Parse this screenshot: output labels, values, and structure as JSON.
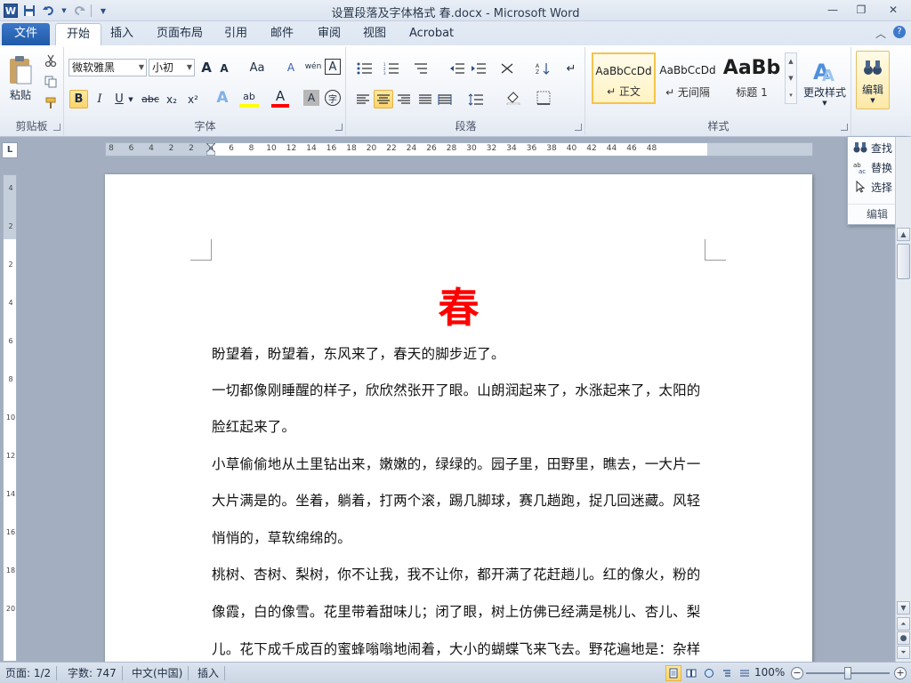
{
  "window": {
    "title": "设置段落及字体格式 春.docx - Microsoft Word",
    "app_icon": "W",
    "minimize": "—",
    "maximize": "❐",
    "close": "✕"
  },
  "tabs": {
    "file": "文件",
    "items": [
      "开始",
      "插入",
      "页面布局",
      "引用",
      "邮件",
      "审阅",
      "视图",
      "Acrobat"
    ],
    "active": "开始"
  },
  "ribbon": {
    "clipboard": {
      "label": "剪贴板",
      "paste": "粘贴"
    },
    "font": {
      "label": "字体",
      "font_name": "微软雅黑",
      "font_size": "小初",
      "grow": "A",
      "shrink": "A",
      "change_case": "Aa",
      "clear": "A",
      "phonetic": "wén",
      "border_char": "A",
      "bold": "B",
      "italic": "I",
      "underline": "U",
      "strike": "abc",
      "subscript": "x₂",
      "superscript": "x²",
      "text_effect": "A",
      "highlight": "ab",
      "font_color": "A",
      "shading": "A",
      "enclose": "字"
    },
    "paragraph": {
      "label": "段落"
    },
    "styles": {
      "label": "样式",
      "items": [
        {
          "sample": "AaBbCcDd",
          "name": "↵ 正文"
        },
        {
          "sample": "AaBbCcDd",
          "name": "↵ 无间隔"
        },
        {
          "sample": "AaBb",
          "name": "标题 1"
        }
      ],
      "change_styles": "更改样式"
    },
    "editing": {
      "label": "编辑",
      "button": "编辑"
    }
  },
  "edit_panel": {
    "find": "查找",
    "replace": "替换",
    "select": "选择",
    "label": "编辑"
  },
  "ruler": {
    "corner": "L",
    "marks": [
      "8",
      "6",
      "4",
      "2",
      "2",
      "4",
      "6",
      "8",
      "10",
      "12",
      "14",
      "16",
      "18",
      "20",
      "22",
      "24",
      "26",
      "28",
      "30",
      "32",
      "34",
      "36",
      "38",
      "40",
      "42",
      "44",
      "46",
      "48"
    ],
    "vmarks": [
      "4",
      "2",
      "2",
      "4",
      "6",
      "8",
      "10",
      "12",
      "14",
      "16",
      "18",
      "20"
    ]
  },
  "document": {
    "title": "春",
    "lines": [
      "盼望着，盼望着，东风来了，春天的脚步近了。",
      "一切都像刚睡醒的样子，欣欣然张开了眼。山朗润起来了，水涨起来了，太阳的",
      "脸红起来了。",
      "小草偷偷地从土里钻出来，嫩嫩的，绿绿的。园子里，田野里，瞧去，一大片一",
      "大片满是的。坐着，躺着，打两个滚，踢几脚球，赛几趟跑，捉几回迷藏。风轻",
      "悄悄的，草软绵绵的。",
      "桃树、杏树、梨树，你不让我，我不让你，都开满了花赶趟儿。红的像火，粉的",
      "像霞，白的像雪。花里带着甜味儿；闭了眼，树上仿佛已经满是桃儿、杏儿、梨",
      "儿。花下成千成百的蜜蜂嗡嗡地闹着，大小的蝴蝶飞来飞去。野花遍地是：杂样"
    ]
  },
  "status": {
    "page": "页面: 1/2",
    "words": "字数: 747",
    "language": "中文(中国)",
    "mode": "插入",
    "zoom": "100%",
    "zoom_level": 100
  }
}
